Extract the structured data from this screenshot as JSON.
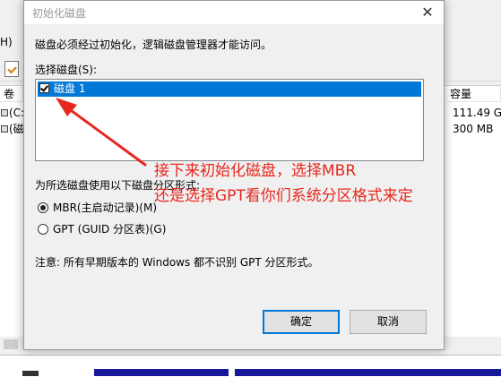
{
  "background": {
    "menu_fragment": "H)",
    "col_left_fragment": "卷",
    "col_capacity": "容量",
    "rows": [
      {
        "vol": "(C:",
        "capacity": "111.49 GB"
      },
      {
        "vol": "(磁盘",
        "capacity": "300 MB"
      }
    ]
  },
  "dialog": {
    "title": "初始化磁盘",
    "close_glyph": "✕",
    "intro": "磁盘必须经过初始化，逻辑磁盘管理器才能访问。",
    "select_label": "选择磁盘(S):",
    "disks": [
      {
        "label": "磁盘 1",
        "checked": true
      }
    ],
    "partition_label": "为所选磁盘使用以下磁盘分区形式:",
    "options": [
      {
        "label": "MBR(主启动记录)(M)",
        "checked": true
      },
      {
        "label": "GPT (GUID 分区表)(G)",
        "checked": false
      }
    ],
    "note": "注意: 所有早期版本的 Windows 都不识别 GPT 分区形式。",
    "ok_label": "确定",
    "cancel_label": "取消"
  },
  "annotation": {
    "color": "#e8271e",
    "line1": "接下来初始化磁盘，选择MBR",
    "line2": "还是选择GPT看你们系统分区格式来定"
  }
}
